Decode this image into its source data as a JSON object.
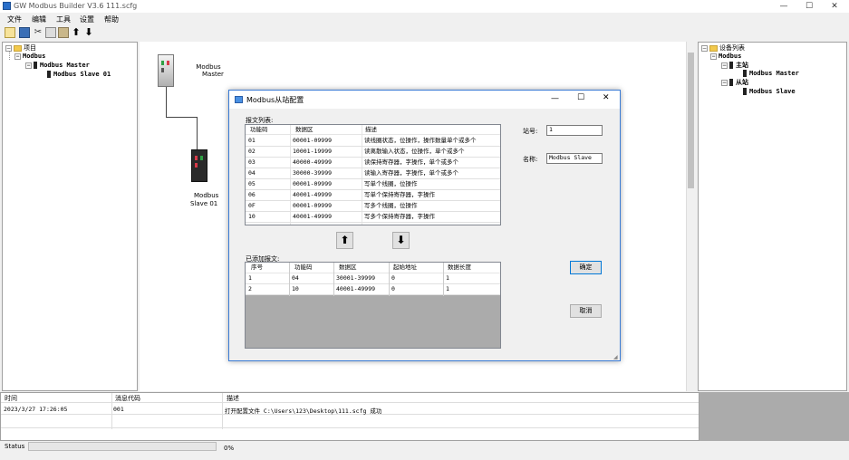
{
  "window": {
    "title": "GW Modbus Builder V3.6   111.scfg",
    "minimize": "—",
    "maximize": "☐",
    "close": "✕"
  },
  "menu": [
    "文件",
    "编辑",
    "工具",
    "设置",
    "帮助"
  ],
  "toolbar": [
    "new-icon",
    "save-icon",
    "cut-icon",
    "copy-icon",
    "paste-icon",
    "upload-icon",
    "download-icon"
  ],
  "left_tree": {
    "root": "项目",
    "modbus": "Modbus",
    "master": "Modbus Master",
    "slave": "Modbus Slave  01"
  },
  "canvas": {
    "master_label_1": "Modbus",
    "master_label_2": "Master",
    "slave_label_1": "Modbus",
    "slave_label_2": "Slave  01"
  },
  "right_tree": {
    "root": "设备列表",
    "modbus": "Modbus",
    "master_group": "主站",
    "master": "Modbus Master",
    "slave_group": "从站",
    "slave": "Modbus Slave"
  },
  "dialog": {
    "title": "Modbus从站配置",
    "list_label": "报文列表:",
    "list_headers": [
      "功能码",
      "数据区",
      "描述"
    ],
    "list_rows": [
      [
        "01",
        "00001-09999",
        "读线圈状态，位操作，操作数量单个或多个"
      ],
      [
        "02",
        "10001-19999",
        "读离散输入状态，位操作，单个或多个"
      ],
      [
        "03",
        "40000-49999",
        "读保持寄存器，字操作，单个或多个"
      ],
      [
        "04",
        "30000-39999",
        "读输入寄存器，字操作，单个或多个"
      ],
      [
        "05",
        "00001-09999",
        "写单个线圈，位操作"
      ],
      [
        "06",
        "40001-49999",
        "写单个保持寄存器，字操作"
      ],
      [
        "0F",
        "00001-09999",
        "写多个线圈，位操作"
      ],
      [
        "10",
        "40001-49999",
        "写多个保持寄存器，字操作"
      ]
    ],
    "station_label": "站号:",
    "station_value": "1",
    "name_label": "名称:",
    "name_value": "Modbus Slave",
    "added_label": "已添加报文:",
    "added_headers": [
      "序号",
      "功能码",
      "数据区",
      "起始地址",
      "数据长度"
    ],
    "added_rows": [
      [
        "1",
        "04",
        "30001-39999",
        "0",
        "1"
      ],
      [
        "2",
        "10",
        "40001-49999",
        "0",
        "1"
      ]
    ],
    "ok": "确定",
    "cancel": "取消"
  },
  "log": {
    "headers": [
      "时间",
      "消息代码",
      "描述"
    ],
    "rows": [
      [
        "2023/3/27 17:26:05",
        "001",
        "打开配置文件 C:\\Users\\123\\Desktop\\111.scfg 成功"
      ]
    ]
  },
  "status": {
    "label": "Status",
    "progress_text": "0%",
    "progress": 0
  }
}
